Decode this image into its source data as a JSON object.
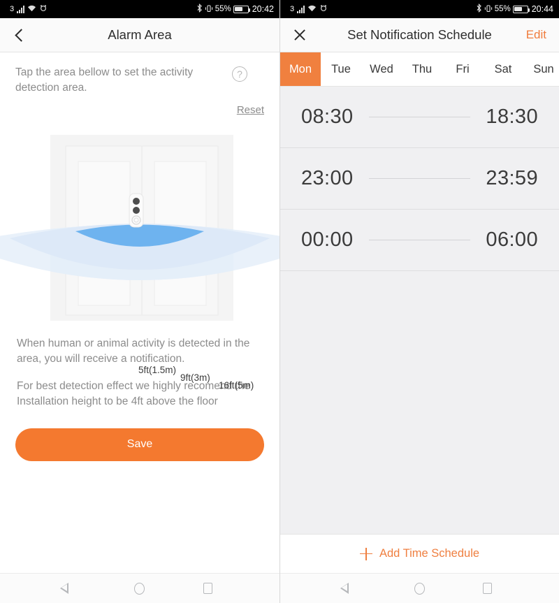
{
  "left": {
    "statusbar": {
      "network": "3",
      "signal_icon": "signal-bars-icon",
      "wifi_icon": "wifi-icon",
      "extra_icon": "app-notification-icon",
      "bluetooth_icon": "bluetooth-icon",
      "vibrate_icon": "vibrate-icon",
      "battery_pct": "55%",
      "battery_icon": "battery-icon",
      "time": "20:42"
    },
    "appbar": {
      "back_icon": "chevron-left-icon",
      "title": "Alarm Area"
    },
    "hint": "Tap the area bellow to set the activity detection area.",
    "help_icon": "question-mark-circle-icon",
    "reset_label": "Reset",
    "zones": [
      {
        "label": "5ft(1.5m)",
        "color": "#6eb3ef"
      },
      {
        "label": "9ft(3m)",
        "color": "#dce8f7"
      },
      {
        "label": "16ft(5m)",
        "color": "#e5eef9"
      }
    ],
    "device_icon": "doorbell-sensor-icon",
    "paragraphs": [
      "When human or animal activity is detected in the area, you will receive a notification.",
      "For best detection effect we highly recomend the Installation height to be 4ft above the floor"
    ],
    "save_label": "Save"
  },
  "right": {
    "statusbar": {
      "network": "3",
      "signal_icon": "signal-bars-icon",
      "wifi_icon": "wifi-icon",
      "extra_icon": "app-notification-icon",
      "bluetooth_icon": "bluetooth-icon",
      "vibrate_icon": "vibrate-icon",
      "battery_pct": "55%",
      "battery_icon": "battery-icon",
      "time": "20:44"
    },
    "appbar": {
      "close_icon": "close-x-icon",
      "title": "Set Notification Schedule",
      "edit_label": "Edit"
    },
    "days": [
      {
        "label": "Mon",
        "active": true
      },
      {
        "label": "Tue",
        "active": false
      },
      {
        "label": "Wed",
        "active": false
      },
      {
        "label": "Thu",
        "active": false
      },
      {
        "label": "Fri",
        "active": false
      },
      {
        "label": "Sat",
        "active": false
      },
      {
        "label": "Sun",
        "active": false
      }
    ],
    "schedules": [
      {
        "start": "08:30",
        "end": "18:30"
      },
      {
        "start": "23:00",
        "end": "23:59"
      },
      {
        "start": "00:00",
        "end": "06:00"
      }
    ],
    "add_label": "Add Time Schedule",
    "add_icon": "plus-icon"
  },
  "navbar": {
    "back_icon": "nav-back-triangle-icon",
    "home_icon": "nav-home-circle-icon",
    "recent_icon": "nav-recents-square-icon"
  },
  "colors": {
    "accent": "#f4792f",
    "tab_active": "#f0803f",
    "zone_inner": "#6eb3ef",
    "zone_outer": "#e5eef9",
    "list_bg": "#f0f0f2"
  }
}
